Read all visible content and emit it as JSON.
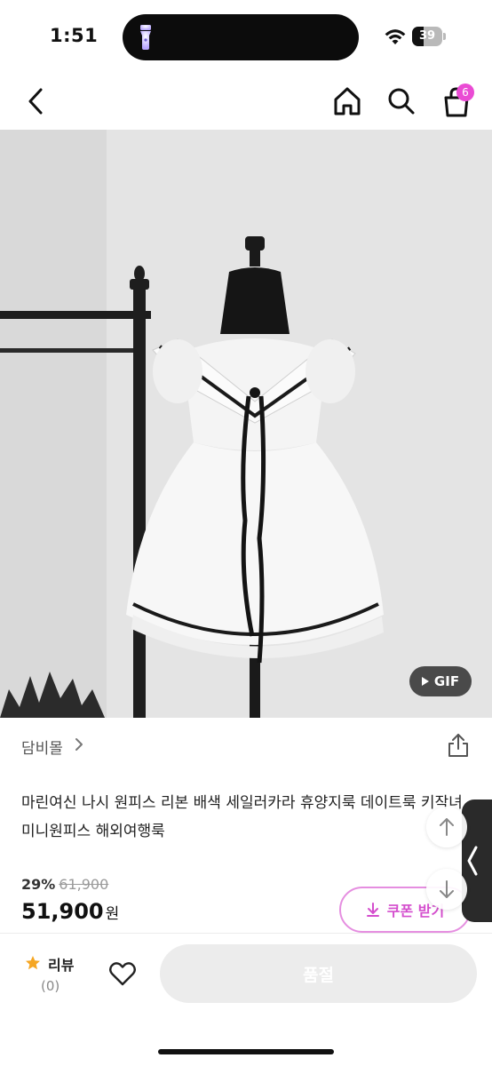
{
  "status_bar": {
    "time": "1:51",
    "battery": "39",
    "battery_level": 0.39,
    "icons": [
      "flashlight-icon",
      "wifi-icon",
      "battery-icon"
    ]
  },
  "nav": {
    "icons": [
      "back-arrow-icon",
      "home-icon",
      "search-icon",
      "shopping-bag-icon"
    ],
    "cart_count": "6",
    "badge_color": "#ea4bd4"
  },
  "product": {
    "gif_label": "GIF",
    "store_name": "담비몰",
    "title": "마린여신 나시 원피스 리본 배색 세일러카라 휴양지룩 데이트룩 키작녀 미니원피스 해외여행룩",
    "discount_rate": "29%",
    "original_price": "61,900",
    "price": "51,900",
    "price_unit": "원"
  },
  "coupon": {
    "label": "쿠폰 받기",
    "color": "#d44dcd"
  },
  "bottom_bar": {
    "review_label": "리뷰",
    "review_count": "(0)",
    "star_color": "#f5a623",
    "soldout_label": "품절"
  }
}
